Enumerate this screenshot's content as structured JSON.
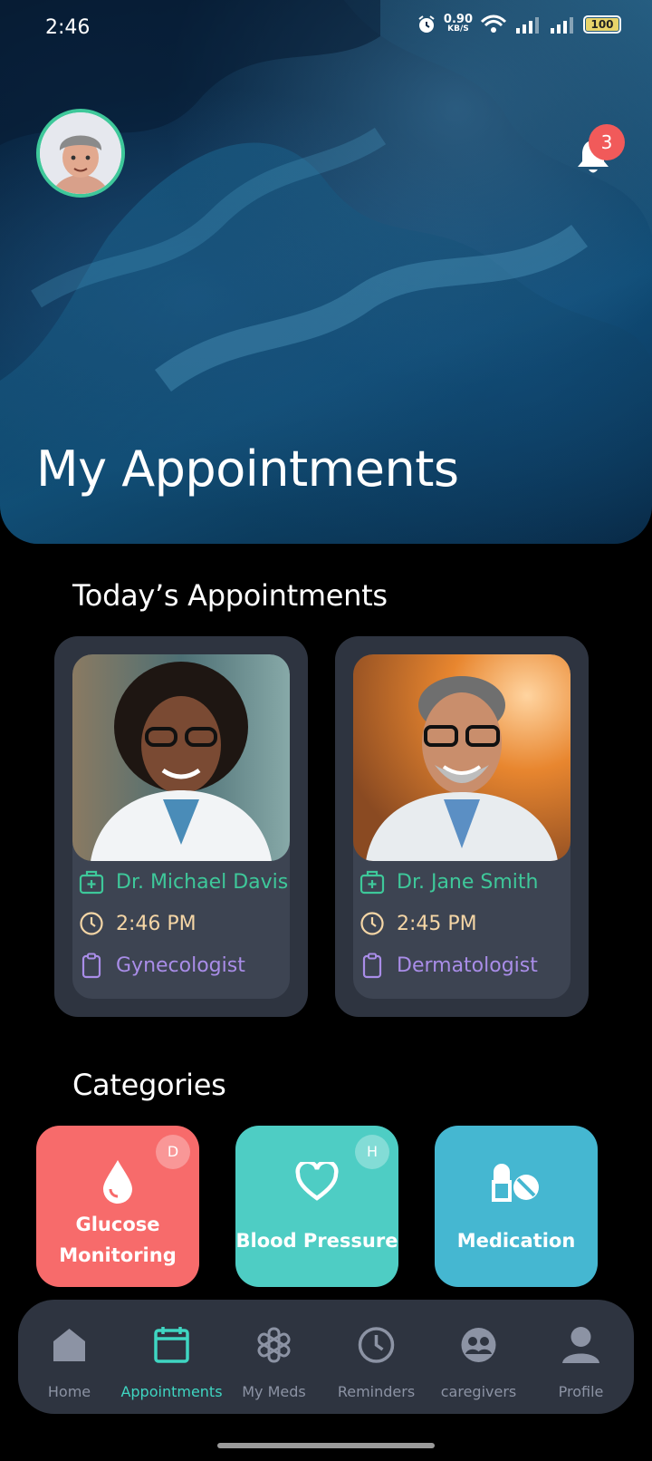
{
  "status_bar": {
    "time": "2:46",
    "net_speed": "0.90",
    "net_unit": "KB/S",
    "battery": "100"
  },
  "header": {
    "notification_count": "3",
    "title": "My Appointments"
  },
  "todays": {
    "title": "Today’s Appointments",
    "cards": [
      {
        "doctor": "Dr. Michael Davis",
        "time": "2:46 PM",
        "specialty": "Gynecologist"
      },
      {
        "doctor": "Dr. Jane Smith",
        "time": "2:45 PM",
        "specialty": "Dermatologist"
      }
    ]
  },
  "categories": {
    "title": "Categories",
    "items": [
      {
        "line1": "Glucose",
        "line2": "Monitoring",
        "letter": "D",
        "color": "#f76b6b",
        "icon": "droplet-icon"
      },
      {
        "line1": "Blood Pressure",
        "letter": "H",
        "color": "#4ecdc4",
        "icon": "heart-icon"
      },
      {
        "line1": "Medication",
        "color": "#45b7d1",
        "icon": "pills-icon"
      }
    ]
  },
  "nav": {
    "items": [
      {
        "label": "Home",
        "icon": "home-icon"
      },
      {
        "label": "Appointments",
        "icon": "calendar-icon",
        "active": true
      },
      {
        "label": "My Meds",
        "icon": "asterisk-icon"
      },
      {
        "label": "Reminders",
        "icon": "clock-icon"
      },
      {
        "label": "caregivers",
        "icon": "caregivers-icon"
      },
      {
        "label": "Profile",
        "icon": "user-icon"
      }
    ]
  },
  "colors": {
    "accent": "#3fd6c2",
    "doctor_text": "#3ec89a",
    "time_text": "#f5d6a6",
    "specialty_text": "#a98de8"
  }
}
